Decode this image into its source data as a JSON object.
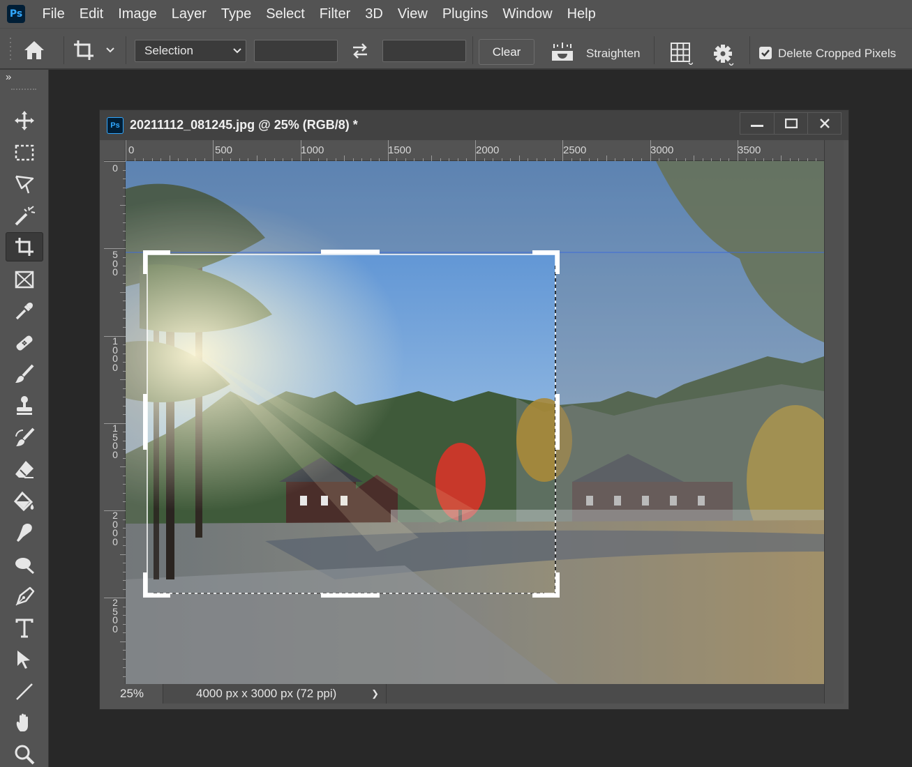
{
  "app": {
    "logo_text": "Ps"
  },
  "menu": [
    "File",
    "Edit",
    "Image",
    "Layer",
    "Type",
    "Select",
    "Filter",
    "3D",
    "View",
    "Plugins",
    "Window",
    "Help"
  ],
  "options": {
    "ratio_select": "Selection",
    "clear_label": "Clear",
    "straighten_label": "Straighten",
    "delete_cropped_label": "Delete Cropped Pixels",
    "delete_cropped_checked": true
  },
  "toolbar": {
    "expand_glyph": "»",
    "tools": [
      "move",
      "rectangular-marquee",
      "lasso",
      "magic-wand",
      "crop",
      "frame",
      "eyedropper",
      "healing-brush",
      "brush",
      "clone-stamp",
      "history-brush",
      "eraser",
      "paint-bucket",
      "smudge",
      "dodge",
      "pen",
      "type",
      "path-selection",
      "line",
      "hand",
      "zoom"
    ],
    "active_tool": "crop"
  },
  "document": {
    "logo_text": "Ps",
    "title": "20211112_081245.jpg @ 25% (RGB/8) *",
    "ruler_h": [
      "0",
      "500",
      "1000",
      "1500",
      "2000",
      "2500",
      "3000",
      "3500"
    ],
    "ruler_v": [
      "0",
      "500",
      "1000",
      "1500",
      "2000",
      "2500"
    ],
    "zoom": "25%",
    "info": "4000 px x 3000 px (72 ppi)",
    "info_arrow": "❯"
  },
  "colors": {
    "panel": "#535353",
    "background": "#282828",
    "sky": "#5b95d6",
    "maple": "#c8382a",
    "grass": "#b59a5e"
  }
}
